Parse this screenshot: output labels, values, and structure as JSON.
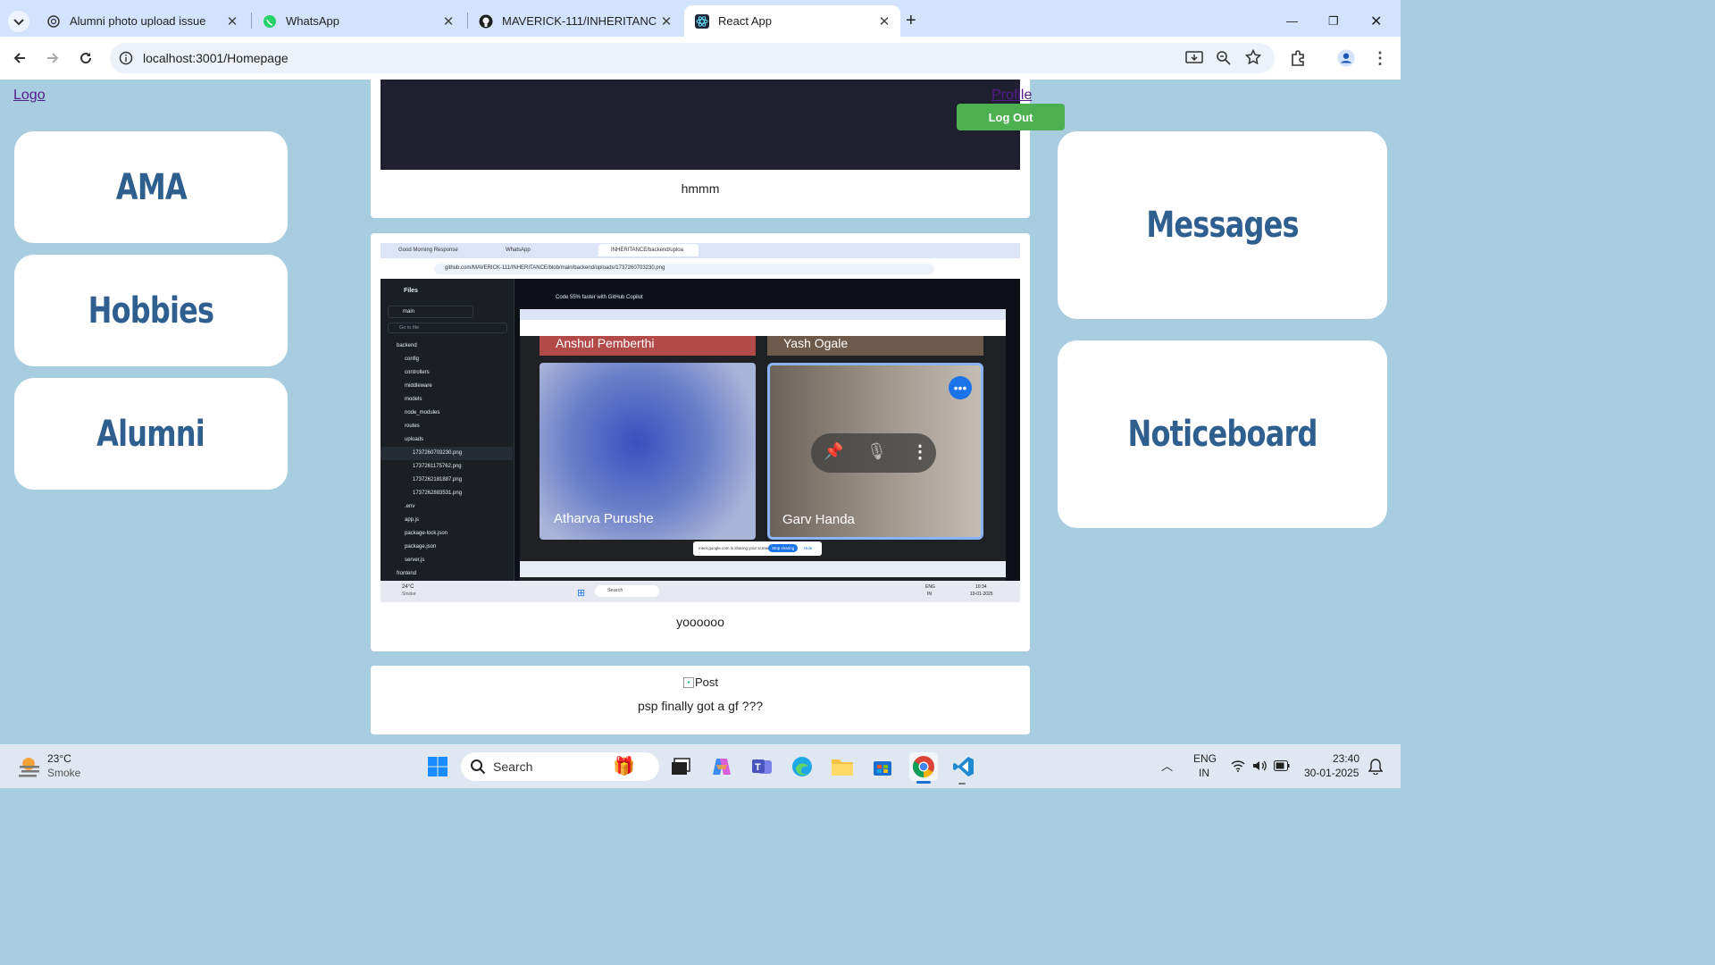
{
  "browser": {
    "tabs": [
      {
        "title": "Alumni photo upload issue",
        "icon": "chatgpt-icon"
      },
      {
        "title": "WhatsApp",
        "icon": "whatsapp-icon"
      },
      {
        "title": "MAVERICK-111/INHERITANCE",
        "icon": "github-icon"
      },
      {
        "title": "React App",
        "icon": "react-icon"
      }
    ],
    "url": "localhost:3001/Homepage"
  },
  "page": {
    "logo": "Logo",
    "profile": "Profile",
    "logout": "Log Out",
    "left_nav": [
      "AMA",
      "Hobbies",
      "Alumni"
    ],
    "right_nav": [
      "Messages",
      "Noticeboard"
    ],
    "posts": [
      {
        "caption": "hmmm"
      },
      {
        "caption": "yoooooo"
      },
      {
        "caption": "psp finally got a gf ???",
        "image_alt": "Post"
      }
    ],
    "screenshot_content": {
      "tabs": [
        "Good Morning Response",
        "WhatsApp",
        "INHERITANCE/backend/uploa"
      ],
      "url": "github.com/MAVERICK-111/INHERITANCE/blob/main/backend/uploads/1737260703230.png",
      "files_title": "Files",
      "branch": "main",
      "go_to_file": "Go to file",
      "file_tree": [
        "backend",
        "config",
        "controllers",
        "middleware",
        "models",
        "node_modules",
        "routes",
        "uploads",
        "1737260703230.png",
        "1737261175762.png",
        "1737262181887.png",
        "1737262883531.png",
        ".env",
        "app.js",
        "package-lock.json",
        "package.json",
        "server.js",
        "frontend"
      ],
      "copilot": "Code 55% faster with GitHub Copilot",
      "participants": [
        "Anshul Pemberthi",
        "Yash Ogale",
        "Atharva Purushe",
        "Garv Handa"
      ],
      "share_bar": "meet.google.com is sharing your screen.",
      "stop_sharing": "Stop sharing",
      "hide": "Hide",
      "weather_temp": "24°C",
      "weather_desc": "Smoke",
      "search": "Search",
      "lang": "ENG",
      "region": "IN",
      "time": "10:34",
      "date": "19-01-2025"
    }
  },
  "taskbar": {
    "temp": "23°C",
    "weather": "Smoke",
    "search": "Search",
    "lang": "ENG",
    "region": "IN",
    "time": "23:40",
    "date": "30-01-2025"
  },
  "colors": {
    "accent": "#4caf50",
    "page_bg": "#a8cde0",
    "card_text": "#2e5f8f",
    "tab_bar": "#d3e3fd"
  }
}
